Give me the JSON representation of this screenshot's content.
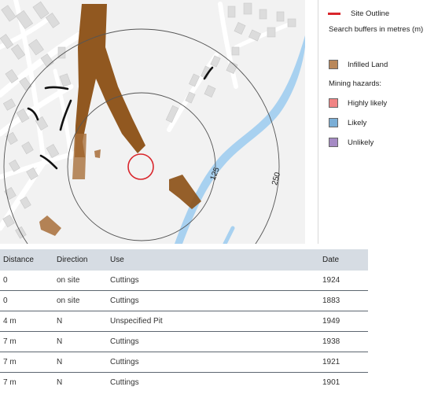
{
  "map": {
    "buffer_labels": [
      "125",
      "250"
    ],
    "colors": {
      "site_outline": "#d9262c",
      "infilled_land": "#8b4f14",
      "water": "#a8d1f0",
      "buildings": "#dcdcdc",
      "buffer_line": "#555555"
    }
  },
  "legend": {
    "site_outline_label": "Site Outline",
    "search_buffers_label": "Search buffers in metres (m)",
    "infilled_label": "Infilled Land",
    "mining_title": "Mining hazards:",
    "hazards": [
      {
        "label": "Highly likely",
        "color": "#f08484"
      },
      {
        "label": "Likely",
        "color": "#7aaed6"
      },
      {
        "label": "Unlikely",
        "color": "#a58ac4"
      }
    ],
    "infilled_color": "#b9875a"
  },
  "table": {
    "headers": {
      "distance": "Distance",
      "direction": "Direction",
      "use": "Use",
      "date": "Date"
    },
    "rows": [
      {
        "distance": "0",
        "direction": "on site",
        "use": "Cuttings",
        "date": "1924"
      },
      {
        "distance": "0",
        "direction": "on site",
        "use": "Cuttings",
        "date": "1883"
      },
      {
        "distance": "4 m",
        "direction": "N",
        "use": "Unspecified Pit",
        "date": "1949"
      },
      {
        "distance": "7 m",
        "direction": "N",
        "use": "Cuttings",
        "date": "1938"
      },
      {
        "distance": "7 m",
        "direction": "N",
        "use": "Cuttings",
        "date": "1921"
      },
      {
        "distance": "7 m",
        "direction": "N",
        "use": "Cuttings",
        "date": "1901"
      }
    ]
  }
}
